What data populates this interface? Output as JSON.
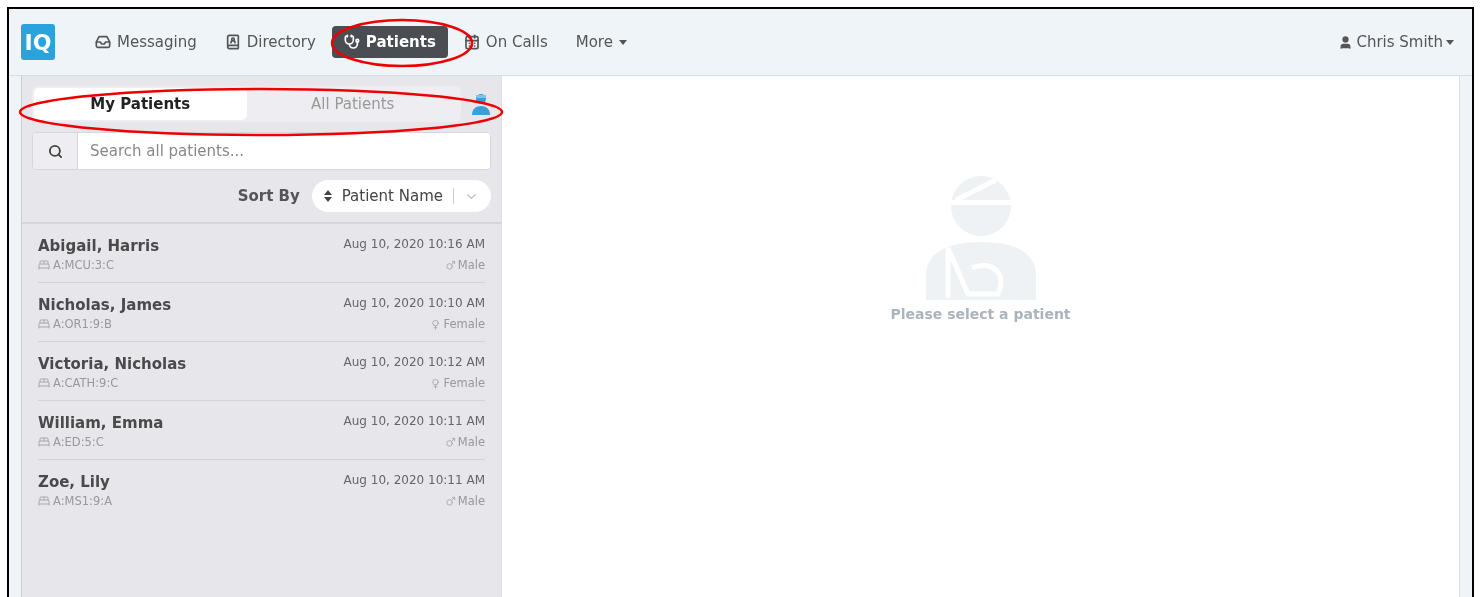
{
  "nav": {
    "logo": "IQ",
    "items": [
      {
        "label": "Messaging",
        "kind": "link",
        "selected": false
      },
      {
        "label": "Directory",
        "kind": "link",
        "selected": false
      },
      {
        "label": "Patients",
        "kind": "link",
        "selected": true
      },
      {
        "label": "On Calls",
        "kind": "link",
        "selected": false
      },
      {
        "label": "More",
        "kind": "dropdown",
        "selected": false
      }
    ],
    "user": "Chris Smith"
  },
  "tabs": [
    {
      "label": "My Patients",
      "selected": true
    },
    {
      "label": "All Patients",
      "selected": false
    }
  ],
  "search": {
    "placeholder": "Search all patients..."
  },
  "sort": {
    "label": "Sort By",
    "value": "Patient Name"
  },
  "patients": [
    {
      "name": "Abigail, Harris",
      "location": "A:MCU:3:C",
      "time": "Aug 10, 2020 10:16 AM",
      "kind": "male",
      "sex": "Male"
    },
    {
      "name": "Nicholas, James",
      "location": "A:OR1:9:B",
      "time": "Aug 10, 2020 10:10 AM",
      "kind": "female",
      "sex": "Female"
    },
    {
      "name": "Victoria, Nicholas",
      "location": "A:CATH:9:C",
      "time": "Aug 10, 2020 10:12 AM",
      "kind": "female",
      "sex": "Female"
    },
    {
      "name": "William, Emma",
      "location": "A:ED:5:C",
      "time": "Aug 10, 2020 10:11 AM",
      "kind": "male",
      "sex": "Male"
    },
    {
      "name": "Zoe, Lily",
      "location": "A:MS1:9:A",
      "time": "Aug 10, 2020 10:11 AM",
      "kind": "male",
      "sex": "Male"
    }
  ],
  "empty": {
    "message": "Please select a patient"
  }
}
